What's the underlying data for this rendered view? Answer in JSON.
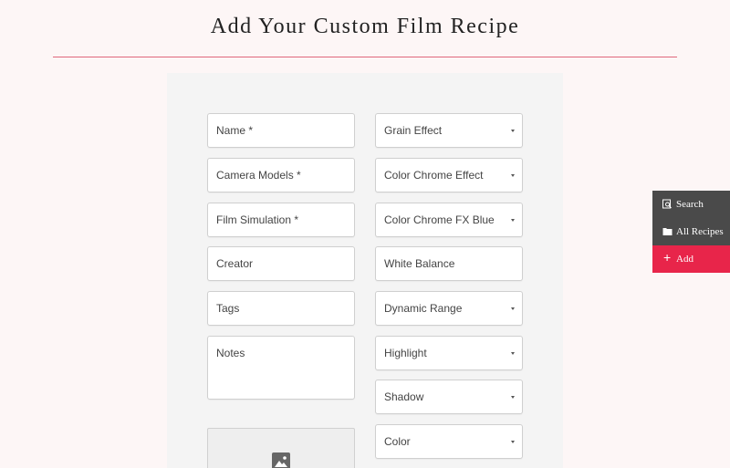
{
  "page": {
    "title": "Add Your Custom Film Recipe"
  },
  "form": {
    "left": {
      "name": "Name *",
      "camera_models": "Camera Models *",
      "film_simulation": "Film Simulation *",
      "creator": "Creator",
      "tags": "Tags",
      "notes": "Notes"
    },
    "right": {
      "grain_effect": "Grain Effect",
      "color_chrome_effect": "Color Chrome Effect",
      "color_chrome_fx_blue": "Color Chrome FX Blue",
      "white_balance": "White Balance",
      "dynamic_range": "Dynamic Range",
      "highlight": "Highlight",
      "shadow": "Shadow",
      "color": "Color"
    },
    "image_upload_icon": "image-icon"
  },
  "sidebar": {
    "items": [
      {
        "label": "Search",
        "icon": "search-icon"
      },
      {
        "label": "All Recipes",
        "icon": "folder-icon"
      },
      {
        "label": "Add",
        "icon": "plus-icon",
        "active": true
      }
    ]
  },
  "colors": {
    "accent": "#e8254a",
    "rule": "#e0687c",
    "sidebar": "#4a4a4a",
    "background": "#fdf6f6",
    "panel": "#f4f4f4"
  }
}
